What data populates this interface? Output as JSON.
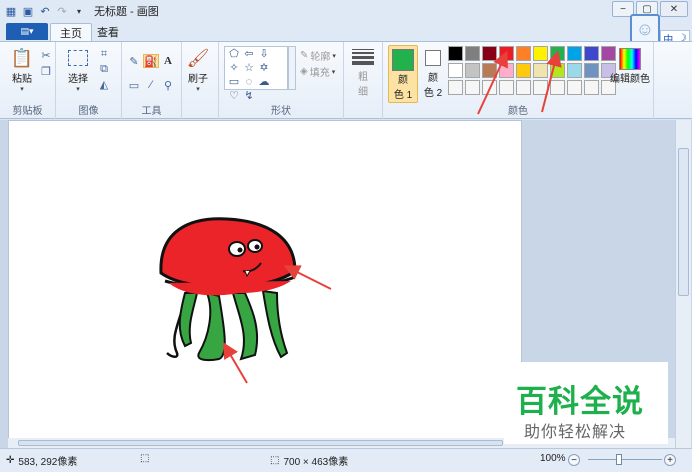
{
  "window": {
    "title": "无标题 - 画图"
  },
  "tabs": {
    "file_label": "▤▾",
    "home": "主页",
    "view": "查看"
  },
  "ime": {
    "mode": "中",
    "moon": "☽"
  },
  "clipboard": {
    "paste": "粘贴",
    "group": "剪贴板"
  },
  "image": {
    "select": "选择",
    "group": "图像"
  },
  "tools": {
    "group": "工具"
  },
  "brush": {
    "label": "刷子"
  },
  "shapes": {
    "outline": "轮廓",
    "fill": "填充",
    "group": "形状"
  },
  "size": {
    "label_line1": "粗",
    "label_line2": "细"
  },
  "colors": {
    "color1_line1": "颜",
    "color1_line2": "色 1",
    "color2_line1": "颜",
    "color2_line2": "色 2",
    "edit": "编辑颜色",
    "group": "颜色",
    "color1_value": "#22b14c",
    "color2_value": "#ffffff",
    "palette_row1": [
      "#000000",
      "#7f7f7f",
      "#880015",
      "#ed1c24",
      "#ff7f27",
      "#fff200",
      "#22b14c",
      "#00a2e8",
      "#3f48cc",
      "#a349a4"
    ],
    "palette_row2": [
      "#ffffff",
      "#c3c3c3",
      "#b97a57",
      "#ffaec9",
      "#ffc90e",
      "#efe4b0",
      "#b5e61d",
      "#99d9ea",
      "#7092be",
      "#c8bfe7"
    ]
  },
  "status": {
    "cursor_pos": "583, 292像素",
    "image_size": "700 × 463像素",
    "zoom": "100%"
  },
  "watermark": {
    "main": "百科全说",
    "sub": "助你轻松解决"
  }
}
